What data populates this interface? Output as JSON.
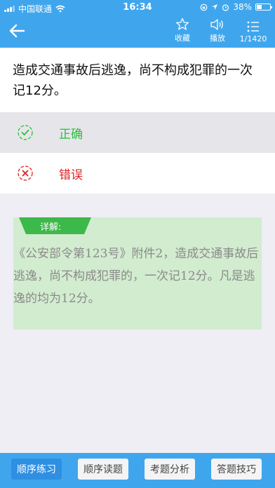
{
  "status_bar": {
    "carrier": "中国联通",
    "time": "16:34",
    "battery": "38%"
  },
  "nav": {
    "back_icon": "back-arrow-icon",
    "favorite_label": "收藏",
    "play_label": "播放",
    "progress": "1/1420"
  },
  "question": {
    "text": "造成交通事故后逃逸，尚不构成犯罪的一次记12分。"
  },
  "options": [
    {
      "label": "正确",
      "icon": "check-circle-icon",
      "color": "#2bbd3c"
    },
    {
      "label": "错误",
      "icon": "cross-circle-icon",
      "color": "#e02020"
    }
  ],
  "explanation": {
    "tag": "详解:",
    "text": "《公安部令第123号》附件2，造成交通事故后逃逸，尚不构成犯罪的，一次记12分。凡是逃逸的均为12分。"
  },
  "bottom_tabs": [
    {
      "label": "顺序练习",
      "active": true
    },
    {
      "label": "顺序读题",
      "active": false
    },
    {
      "label": "考题分析",
      "active": false
    },
    {
      "label": "答题技巧",
      "active": false
    }
  ],
  "colors": {
    "primary": "#3fa6ee",
    "active_tab": "#2f8fe3",
    "explanation_bg": "#d2eccf",
    "tag_green": "#3db84a"
  }
}
